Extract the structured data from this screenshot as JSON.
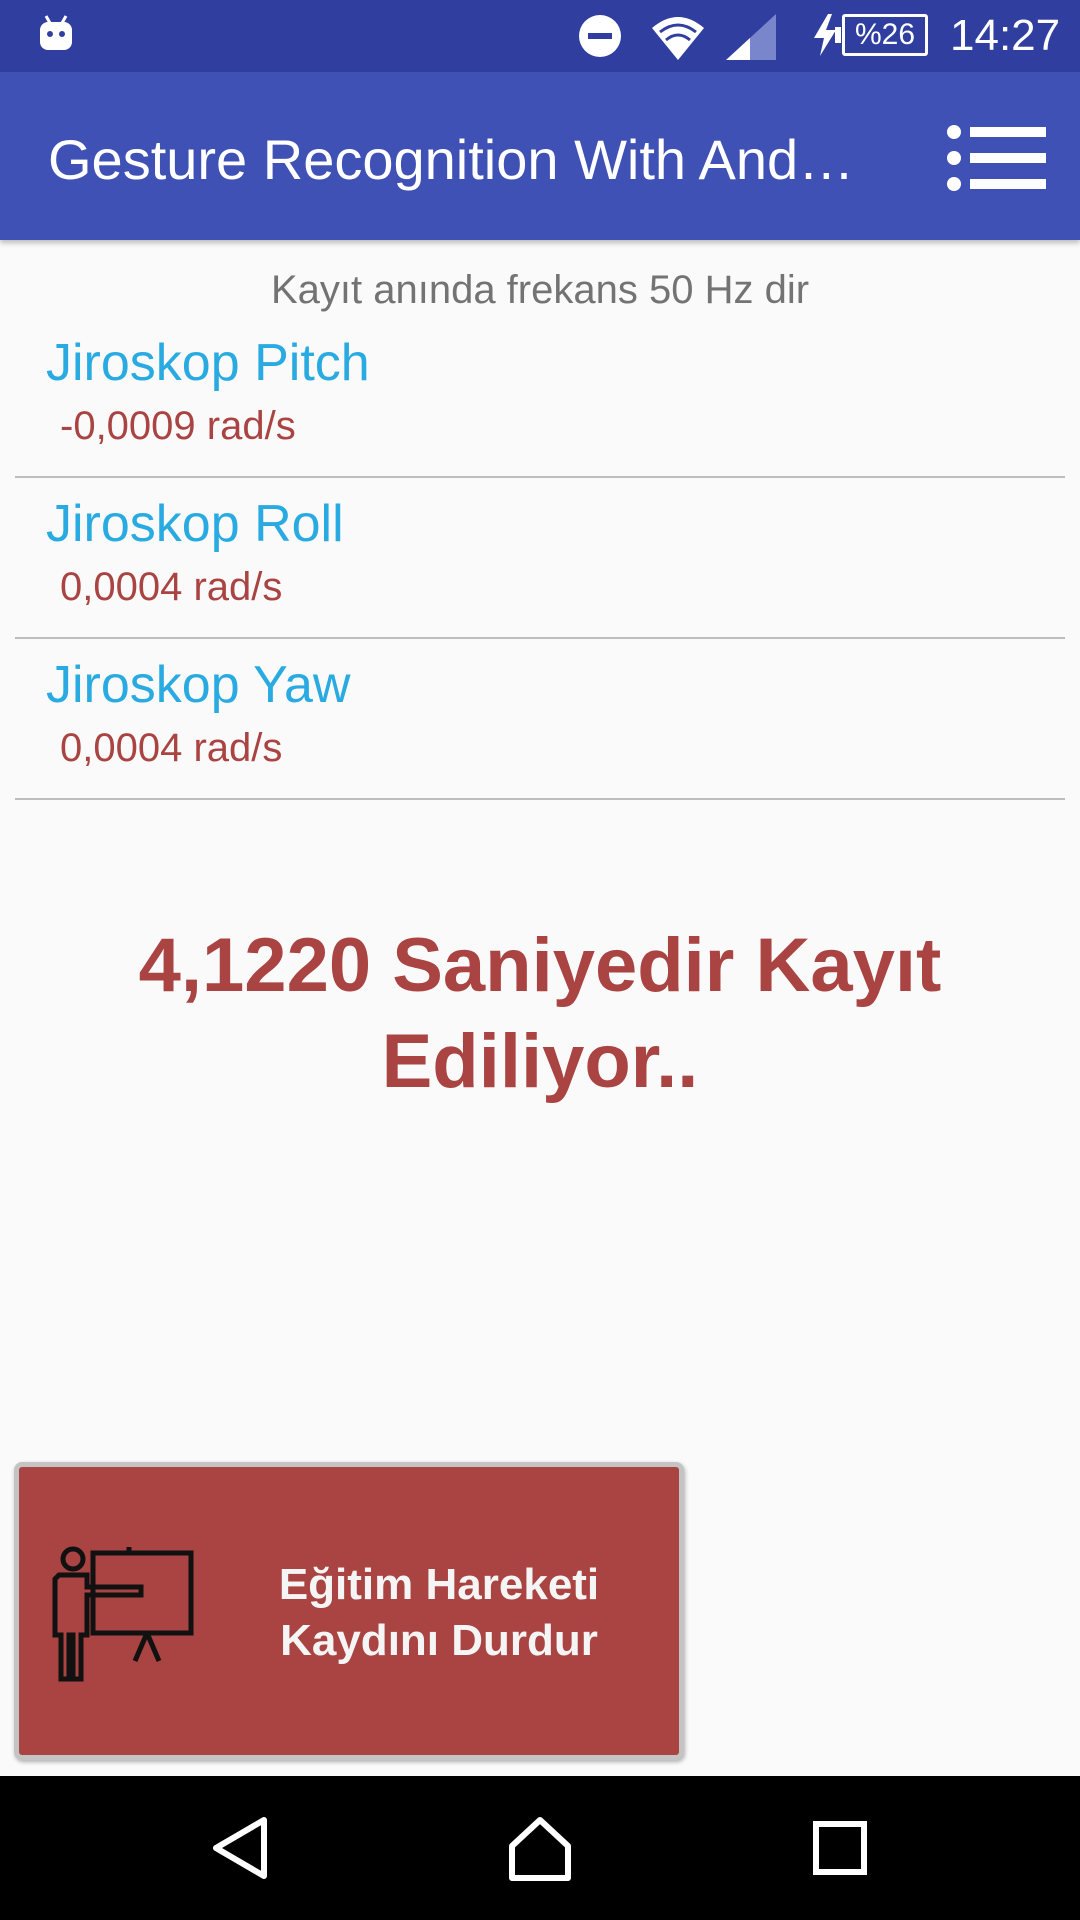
{
  "status_bar": {
    "time": "14:27",
    "battery": "%26",
    "icons": [
      "android-icon",
      "do-not-disturb-icon",
      "wifi-icon",
      "cell-signal-icon",
      "charging-icon",
      "battery-icon"
    ]
  },
  "app_bar": {
    "title": "Gesture Recognition With Android",
    "menu_icon": "menu-list-icon"
  },
  "content": {
    "frequency_note": "Kayıt anında frekans 50 Hz dir",
    "sensors": [
      {
        "name": "Jiroskop Pitch",
        "value": "-0,0009 rad/s"
      },
      {
        "name": "Jiroskop Roll",
        "value": "0,0004 rad/s"
      },
      {
        "name": "Jiroskop Yaw",
        "value": "0,0004 rad/s"
      }
    ],
    "recording_status": "4,1220 Saniyedir Kayıt Ediliyor..",
    "stop_button": {
      "icon": "teacher-presentation-icon",
      "line1": "Eğitim Hareketi",
      "line2": "Kaydını Durdur"
    }
  },
  "nav_bar": {
    "icons": [
      "back-icon",
      "home-icon",
      "recents-icon"
    ]
  },
  "colors": {
    "status_bar": "#303f9f",
    "app_bar": "#3f51b5",
    "sensor_name": "#29abe2",
    "accent_red": "#a94442",
    "background": "#fafafa"
  }
}
